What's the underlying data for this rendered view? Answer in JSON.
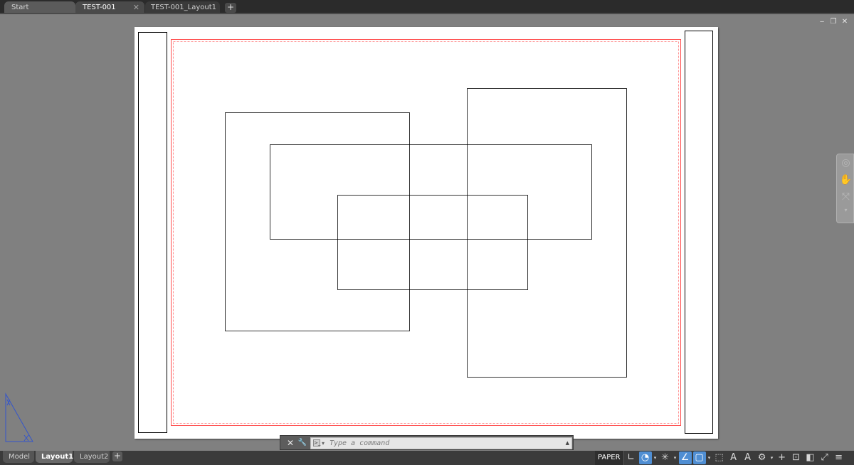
{
  "tabs": [
    {
      "label": "Start"
    },
    {
      "label": "TEST-001",
      "close": "✕"
    },
    {
      "label": "TEST-001_Layout1"
    }
  ],
  "new_tab": "+",
  "window_controls": {
    "minimize": "‒",
    "restore": "❐",
    "close": "✕"
  },
  "command_line": {
    "close_icon": "✕",
    "settings_icon": "🔧",
    "placeholder": "Type a command",
    "history_caret": "▲"
  },
  "layout_tabs": [
    {
      "label": "Model"
    },
    {
      "label": "Layout1",
      "active": true
    },
    {
      "label": "Layout2"
    }
  ],
  "layout_add": "+",
  "status": {
    "paper_label": "PAPER"
  },
  "colors": {
    "margin_line": "#ff4d4d",
    "osnap_active": "#4f8ed3",
    "ucs": "#3355cc"
  },
  "icons": [
    "grid-icon",
    "polar-icon",
    "osnap-track-icon",
    "angle-icon",
    "snap-object-icon",
    "selection-cycling-icon",
    "annotation-scale-icon",
    "annotation-visibility-icon",
    "gear-icon",
    "plus-icon",
    "units-icon",
    "isolate-icon",
    "fullscreen-icon",
    "menu-icon"
  ]
}
